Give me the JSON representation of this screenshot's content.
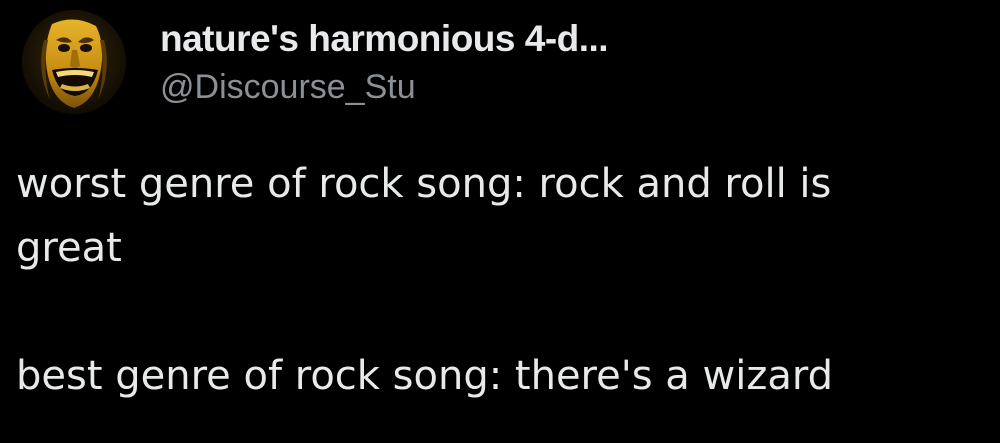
{
  "author": {
    "display_name": "nature's harmonious 4-d...",
    "handle": "@Discourse_Stu",
    "avatar_icon": "grinning-gold-face-avatar"
  },
  "tweet": {
    "lines": [
      "worst genre of rock song: rock and roll is",
      "great",
      "",
      "best genre of rock song: there's a wizard"
    ]
  },
  "colors": {
    "background": "#000000",
    "primary_text": "#e7e9ea",
    "secondary_text": "#8b9096",
    "avatar_gold": "#c9981c"
  }
}
